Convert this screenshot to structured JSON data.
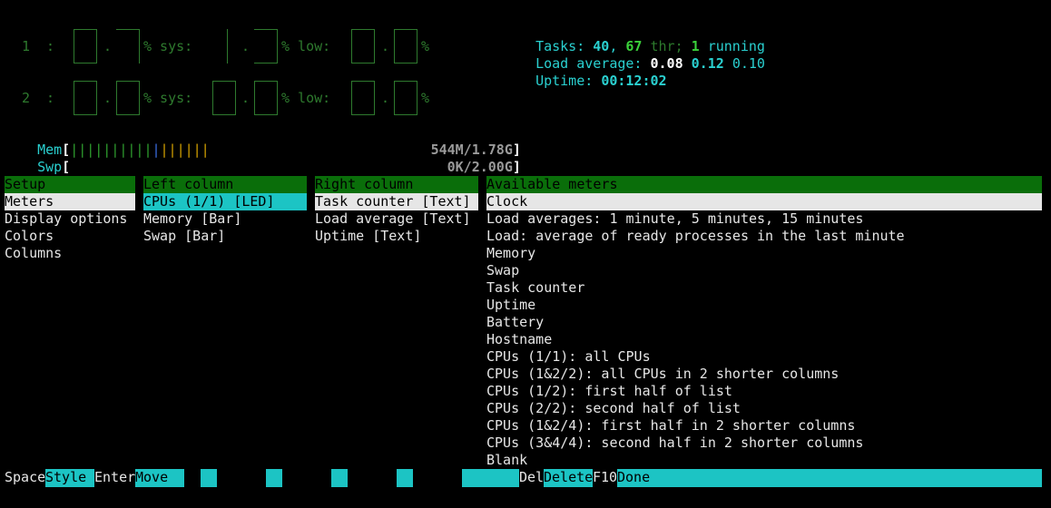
{
  "header": {
    "cpu_rows": [
      {
        "num": "1",
        "sys_label": "% sys:",
        "low_label": "% low:",
        "pct": "%"
      },
      {
        "num": "2",
        "sys_label": "% sys:",
        "low_label": "% low:",
        "pct": "%"
      }
    ],
    "mem_label": "Mem",
    "mem_value": "544M/1.78G",
    "mem_fraction": 0.306,
    "swp_label": "Swp",
    "swp_value": "0K/2.00G",
    "swp_fraction": 0.0,
    "tasks_label": "Tasks:",
    "tasks_count": "40",
    "tasks_threads": "67",
    "tasks_thr_label": "thr;",
    "tasks_running": "1",
    "tasks_running_label": "running",
    "load_label": "Load average:",
    "load_1": "0.08",
    "load_5": "0.12",
    "load_15": "0.10",
    "uptime_label": "Uptime:",
    "uptime_value": "00:12:02"
  },
  "setup": {
    "header": "Setup",
    "items": [
      "Meters",
      "Display options",
      "Colors",
      "Columns"
    ]
  },
  "left_column": {
    "header": "Left column",
    "items": [
      "CPUs (1/1) [LED]",
      "Memory [Bar]",
      "Swap [Bar]"
    ]
  },
  "right_column": {
    "header": "Right column",
    "items": [
      "Task counter [Text]",
      "Load average [Text]",
      "Uptime [Text]"
    ]
  },
  "available_meters": {
    "header": "Available meters",
    "items": [
      "Clock",
      "Load averages: 1 minute, 5 minutes, 15 minutes",
      "Load: average of ready processes in the last minute",
      "Memory",
      "Swap",
      "Task counter",
      "Uptime",
      "Battery",
      "Hostname",
      "CPUs (1/1): all CPUs",
      "CPUs (1&2/2): all CPUs in 2 shorter columns",
      "CPUs (1/2): first half of list",
      "CPUs (2/2): second half of list",
      "CPUs (1&2/4): first half in 2 shorter columns",
      "CPUs (3&4/4): second half in 2 shorter columns",
      "Blank"
    ]
  },
  "footer": {
    "space_key": "Space",
    "space_action": "Style",
    "enter_key": "Enter",
    "enter_action": "Move",
    "del_key": "Del",
    "del_action": "Delete",
    "f10_key": "F10",
    "f10_action": "Done"
  },
  "colors": {
    "panel_header_bg": "#0a6e0a",
    "selection_cyan": "#1cc4c4",
    "text_cyan": "#2ad0d0",
    "text_green": "#3a9c3a"
  }
}
